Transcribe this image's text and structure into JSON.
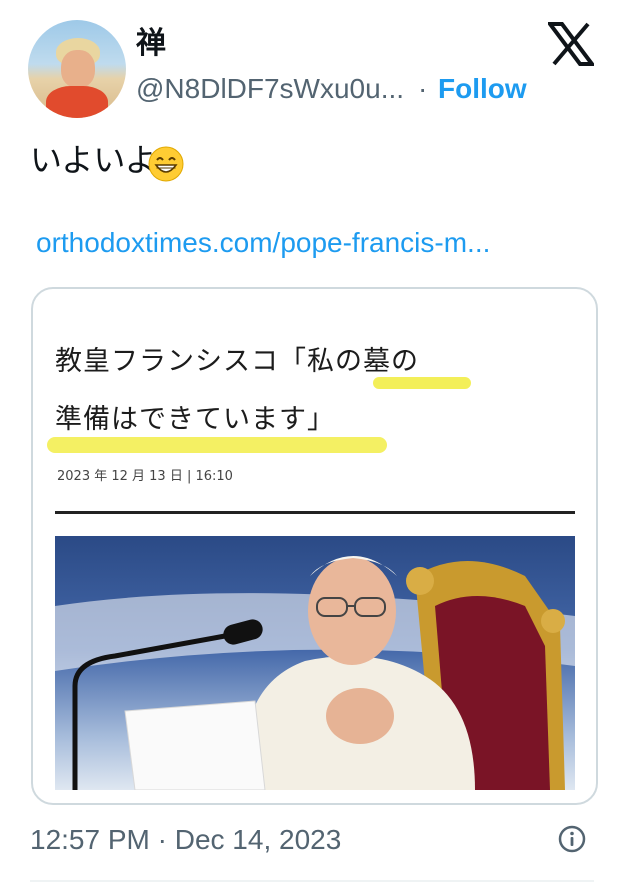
{
  "tweet": {
    "display_name": "禅",
    "handle": "@N8DlDF7sWxu0u...",
    "separator": "·",
    "follow_label": "Follow",
    "text": "いよいよ",
    "emoji": "grinning-face-with-smiling-eyes-icon",
    "link_text": "orthodoxtimes.com/pope-francis-m...",
    "timestamp": "12:57 PM · Dec 14, 2023"
  },
  "card": {
    "headline_line1": "教皇フランシスコ「私の墓の",
    "headline_line2": "準備はできています」",
    "date": "2023 年 12 月 13 日 | 16:10"
  },
  "icons": {
    "logo": "x-logo-icon",
    "info": "info-icon"
  },
  "colors": {
    "link": "#1d9bf0",
    "muted": "#536471",
    "highlight": "#f1ec3c",
    "border": "#cfd9de"
  }
}
